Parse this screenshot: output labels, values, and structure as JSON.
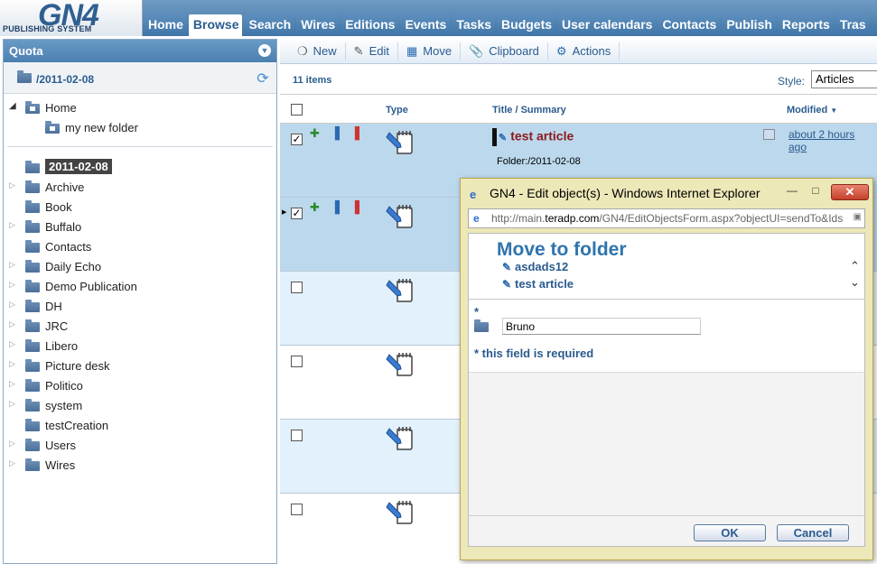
{
  "app": {
    "logo_text": "GN4",
    "logo_sub": "PUBLISHING SYSTEM"
  },
  "nav": {
    "tabs": [
      {
        "label": "Home",
        "active": false
      },
      {
        "label": "Browse",
        "active": true
      },
      {
        "label": "Search",
        "active": false
      },
      {
        "label": "Wires",
        "active": false
      },
      {
        "label": "Editions",
        "active": false
      },
      {
        "label": "Events",
        "active": false
      },
      {
        "label": "Tasks",
        "active": false
      },
      {
        "label": "Budgets",
        "active": false
      },
      {
        "label": "User calendars",
        "active": false
      },
      {
        "label": "Contacts",
        "active": false
      },
      {
        "label": "Publish",
        "active": false
      },
      {
        "label": "Reports",
        "active": false
      },
      {
        "label": "Tras",
        "active": false
      }
    ]
  },
  "left_panel": {
    "title": "Quota",
    "current_path": "/2011-02-08",
    "tree_top": [
      {
        "label": "Home",
        "expanded": true,
        "indent": 0
      },
      {
        "label": "my new folder",
        "expanded": false,
        "indent": 1
      }
    ],
    "tree": [
      {
        "label": "2011-02-08",
        "selected": true,
        "has_children": false
      },
      {
        "label": "Archive",
        "selected": false,
        "has_children": true
      },
      {
        "label": "Book",
        "selected": false,
        "has_children": false
      },
      {
        "label": "Buffalo",
        "selected": false,
        "has_children": true
      },
      {
        "label": "Contacts",
        "selected": false,
        "has_children": false
      },
      {
        "label": "Daily Echo",
        "selected": false,
        "has_children": true
      },
      {
        "label": "Demo Publication",
        "selected": false,
        "has_children": true
      },
      {
        "label": "DH",
        "selected": false,
        "has_children": true
      },
      {
        "label": "JRC",
        "selected": false,
        "has_children": true
      },
      {
        "label": "Libero",
        "selected": false,
        "has_children": true
      },
      {
        "label": "Picture desk",
        "selected": false,
        "has_children": true
      },
      {
        "label": "Politico",
        "selected": false,
        "has_children": true
      },
      {
        "label": "system",
        "selected": false,
        "has_children": true
      },
      {
        "label": "testCreation",
        "selected": false,
        "has_children": false
      },
      {
        "label": "Users",
        "selected": false,
        "has_children": true
      },
      {
        "label": "Wires",
        "selected": false,
        "has_children": true
      }
    ]
  },
  "toolbar": {
    "new_label": "New",
    "edit_label": "Edit",
    "move_label": "Move",
    "clipboard_label": "Clipboard",
    "actions_label": "Actions"
  },
  "list": {
    "items_count": "11 items",
    "style_label": "Style:",
    "style_value": "Articles",
    "columns": {
      "type": "Type",
      "title": "Title / Summary",
      "modified": "Modified"
    },
    "rows": [
      {
        "checked": true,
        "title": "test article",
        "folder": "Folder:/2011-02-08",
        "modified": "about 2 hours ago",
        "bg": "#bcd8ec"
      },
      {
        "checked": true,
        "title": "",
        "folder": "",
        "modified": "",
        "bg": "#bcd8ec"
      },
      {
        "checked": false,
        "title": "",
        "folder": "",
        "modified": "",
        "bg": "#e2f1fb"
      },
      {
        "checked": false,
        "title": "",
        "folder": "",
        "modified": "",
        "bg": "#ffffff"
      },
      {
        "checked": false,
        "title": "",
        "folder": "",
        "modified": "",
        "bg": "#e2f1fb"
      },
      {
        "checked": false,
        "title": "",
        "folder": "",
        "modified": "",
        "bg": "#ffffff"
      }
    ]
  },
  "dialog": {
    "window_title": "GN4 - Edit object(s) - Windows Internet Explorer",
    "url_pre": "http://main.",
    "url_bold": "teradp.com",
    "url_post": "/GN4/EditObjectsForm.aspx?objectUI=sendTo&Ids",
    "heading": "Move to folder",
    "objects": [
      "asdads12",
      "test article"
    ],
    "required_star": "*",
    "folder_value": "Bruno",
    "required_note": "* this field is required",
    "ok_label": "OK",
    "cancel_label": "Cancel"
  },
  "colors": {
    "accent": "#2a5b8f",
    "title_red": "#8b1a1a",
    "selected_row": "#bcd8ec",
    "dialog_frame": "#ede8b8"
  }
}
